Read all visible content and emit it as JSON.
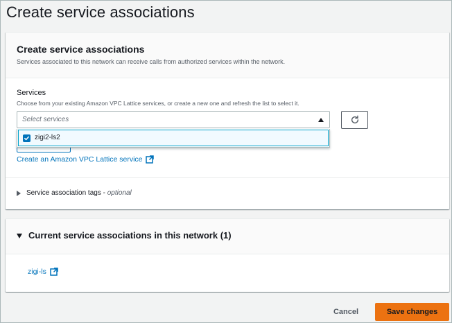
{
  "page": {
    "title": "Create service associations"
  },
  "services_panel": {
    "title": "Create service associations",
    "description": "Services associated to this network can receive calls from authorized services within the network.",
    "services_field": {
      "label": "Services",
      "description": "Choose from your existing Amazon VPC Lattice services, or create a new one and refresh the list to select it.",
      "placeholder": "Select services",
      "options": [
        {
          "label": "zigi2-ls2",
          "checked": true
        }
      ]
    },
    "create_link": "Create an Amazon VPC Lattice service",
    "tags": {
      "label": "Service association tags",
      "separator": " - ",
      "optional": "optional"
    }
  },
  "current_panel": {
    "title": "Current service associations in this network (1)",
    "items": [
      {
        "label": "zigi-ls"
      }
    ]
  },
  "footer": {
    "cancel_label": "Cancel",
    "save_label": "Save changes"
  },
  "colors": {
    "accent": "#ec7211",
    "link": "#0073bb",
    "border": "#aab7b8"
  },
  "icons": [
    "refresh-icon",
    "caret-up-icon",
    "checkbox-checked-icon",
    "external-link-icon",
    "caret-right-icon",
    "caret-down-icon"
  ]
}
